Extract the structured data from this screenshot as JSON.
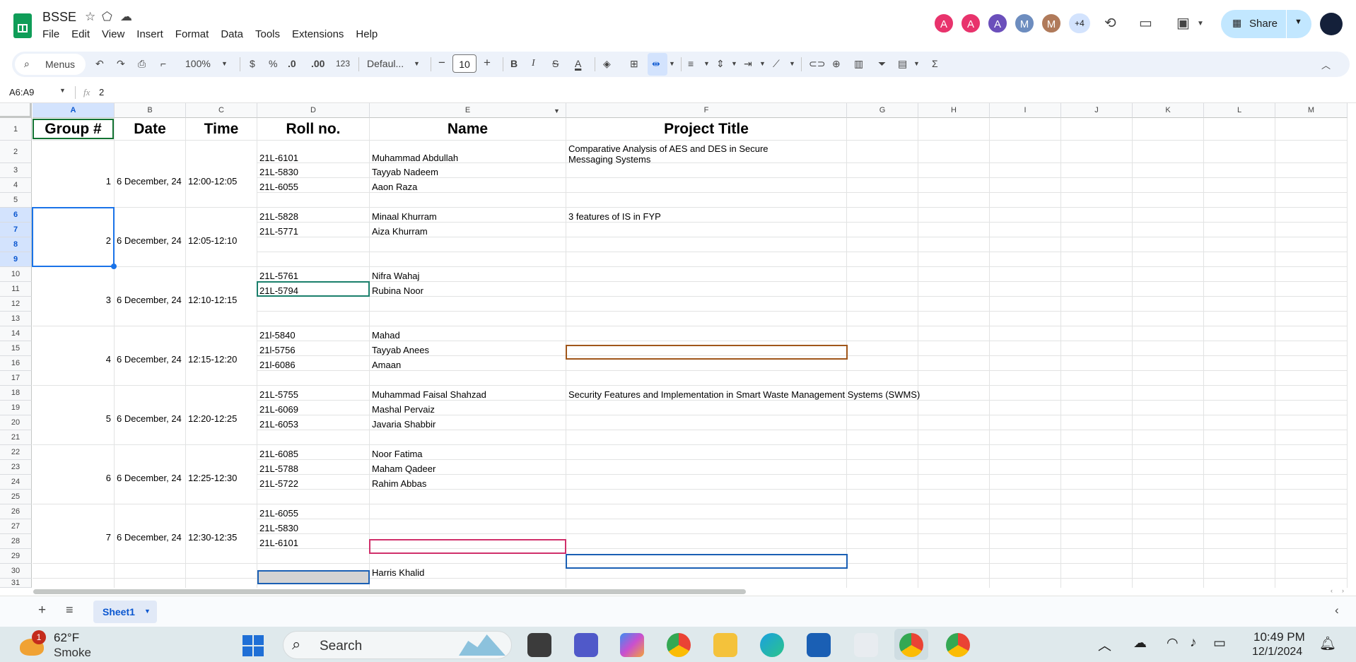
{
  "doc": {
    "title": "BSSE",
    "menu": [
      "File",
      "Edit",
      "View",
      "Insert",
      "Format",
      "Data",
      "Tools",
      "Extensions",
      "Help"
    ]
  },
  "collaborators": [
    {
      "initial": "A",
      "color": "#e8336c"
    },
    {
      "initial": "A",
      "color": "#e8336c"
    },
    {
      "initial": "A",
      "color": "#6b4fbb"
    },
    {
      "initial": "M",
      "color": "#6d8dbf"
    },
    {
      "initial": "M",
      "color": "#b07a5a"
    }
  ],
  "collaborators_more": "+4",
  "share_label": "Share",
  "toolbar": {
    "menus_label": "Menus",
    "zoom": "100%",
    "currency": "$",
    "percent": "%",
    "dec_dec": ".0",
    "inc_dec": ".00",
    "format_123": "123",
    "font": "Defaul...",
    "font_size": "10",
    "bold": "B",
    "italic": "I",
    "strike": "S",
    "text_color": "A",
    "sigma": "Σ"
  },
  "formula": {
    "name_box": "A6:A9",
    "fx": "fx",
    "value": "2"
  },
  "columns": [
    "A",
    "B",
    "C",
    "D",
    "E",
    "F",
    "G",
    "H",
    "I",
    "J",
    "K",
    "L",
    "M"
  ],
  "rows": [
    "1",
    "2",
    "3",
    "4",
    "5",
    "6",
    "7",
    "8",
    "9",
    "10",
    "11",
    "12",
    "13",
    "14",
    "15",
    "16",
    "17",
    "18",
    "19",
    "20",
    "21",
    "22",
    "23",
    "24",
    "25",
    "26",
    "27",
    "28",
    "29",
    "30",
    "31"
  ],
  "headers": {
    "group": "Group #",
    "date": "Date",
    "time": "Time",
    "roll": "Roll no.",
    "name": "Name",
    "project": "Project Title"
  },
  "groups": [
    {
      "num": "1",
      "date": "6 December, 24",
      "time": "12:00-12:05"
    },
    {
      "num": "2",
      "date": "6 December, 24",
      "time": "12:05-12:10"
    },
    {
      "num": "3",
      "date": "6 December, 24",
      "time": "12:10-12:15"
    },
    {
      "num": "4",
      "date": "6 December, 24",
      "time": "12:15-12:20"
    },
    {
      "num": "5",
      "date": "6 December, 24",
      "time": "12:20-12:25"
    },
    {
      "num": "6",
      "date": "6 December, 24",
      "time": "12:25-12:30"
    },
    {
      "num": "7",
      "date": "6 December, 24",
      "time": "12:30-12:35"
    }
  ],
  "students": [
    {
      "roll": "21L-6101",
      "name": "Muhammad Abdullah"
    },
    {
      "roll": "21L-5830",
      "name": "Tayyab Nadeem"
    },
    {
      "roll": "21L-6055",
      "name": "Aaon Raza"
    },
    {
      "roll": "21L-5828",
      "name": "Minaal Khurram"
    },
    {
      "roll": "21L-5771",
      "name": "Aiza Khurram"
    },
    {
      "roll": "21L-5761",
      "name": "Nifra Wahaj"
    },
    {
      "roll": "21L-5794",
      "name": "Rubina Noor"
    },
    {
      "roll": "21l-5840",
      "name": "Mahad"
    },
    {
      "roll": "21l-5756",
      "name": "Tayyab Anees"
    },
    {
      "roll": "21l-6086",
      "name": "Amaan"
    },
    {
      "roll": "21L-5755",
      "name": "Muhammad Faisal Shahzad"
    },
    {
      "roll": "21L-6069",
      "name": "Mashal Pervaiz"
    },
    {
      "roll": "21L-6053",
      "name": "Javaria Shabbir"
    },
    {
      "roll": "21L-6085",
      "name": "Noor Fatima"
    },
    {
      "roll": "21L-5788",
      "name": "Maham Qadeer"
    },
    {
      "roll": "21L-5722",
      "name": "Rahim Abbas"
    },
    {
      "roll": "21L-6055",
      "name": ""
    },
    {
      "roll": "21L-5830",
      "name": ""
    },
    {
      "roll": "21L-6101",
      "name": ""
    },
    {
      "roll": "",
      "name": "Harris Khalid"
    }
  ],
  "projects": {
    "g1_line1": "Comparative Analysis of AES and DES in Secure",
    "g1_line2": " Messaging Systems",
    "g2": "3 features of IS in FYP",
    "g5": "Security Features and Implementation in Smart Waste Management Systems (SWMS)"
  },
  "sheet_tab": "Sheet1",
  "taskbar": {
    "weather_temp": "62°F",
    "weather_desc": "Smoke",
    "weather_badge": "1",
    "search": "Search",
    "time": "10:49 PM",
    "date": "12/1/2024"
  }
}
